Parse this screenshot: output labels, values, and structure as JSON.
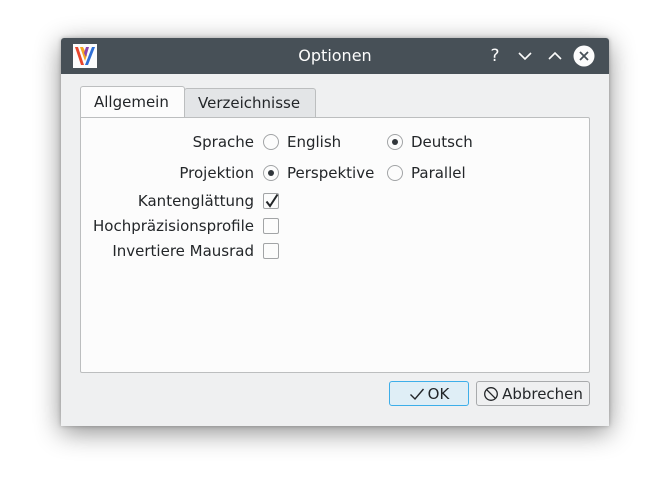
{
  "dialog": {
    "title": "Optionen",
    "titlebar_buttons": {
      "help": "?",
      "minimize_icon": "chevron-down-icon",
      "maximize_icon": "chevron-up-icon",
      "close_icon": "close-circle-icon"
    }
  },
  "tabs": [
    {
      "label": "Allgemein",
      "active": true
    },
    {
      "label": "Verzeichnisse",
      "active": false
    }
  ],
  "settings": {
    "language": {
      "label": "Sprache",
      "options": [
        {
          "label": "English",
          "selected": false
        },
        {
          "label": "Deutsch",
          "selected": true
        }
      ]
    },
    "projection": {
      "label": "Projektion",
      "options": [
        {
          "label": "Perspektive",
          "selected": true
        },
        {
          "label": "Parallel",
          "selected": false
        }
      ]
    },
    "antialiasing": {
      "label": "Kantenglättung",
      "checked": true
    },
    "high_precision_profiles": {
      "label": "Hochpräzisionsprofile",
      "checked": false
    },
    "invert_mouse_wheel": {
      "label": "Invertiere Mausrad",
      "checked": false
    }
  },
  "buttons": {
    "ok": "OK",
    "cancel": "Abbrechen"
  },
  "colors": {
    "titlebar": "#475057",
    "window_bg": "#eff0f1",
    "panel_bg": "#fcfcfc",
    "focus_accent": "#3daee9"
  }
}
